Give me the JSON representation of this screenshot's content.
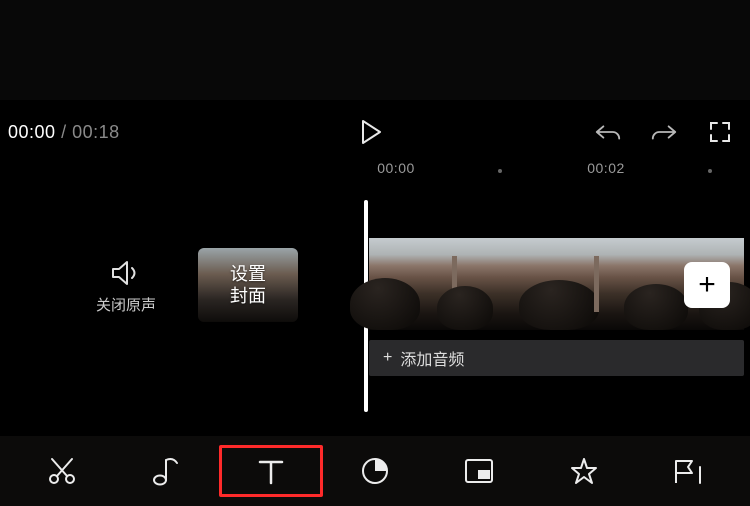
{
  "time": {
    "current": "00:00",
    "separator": "/",
    "duration": "00:18"
  },
  "ruler": {
    "t0": "00:00",
    "t1": "00:02"
  },
  "mute": {
    "label": "关闭原声"
  },
  "cover": {
    "line1": "设置",
    "line2": "封面"
  },
  "add": {
    "symbol": "+"
  },
  "audio": {
    "plus": "+",
    "label": "添加音频"
  },
  "tools": {
    "cut": "scissors-icon",
    "music": "music-note-icon",
    "text": "text-icon",
    "sticker": "sticker-icon",
    "pip": "picture-in-picture-icon",
    "effect": "star-effect-icon",
    "more": "flag-icon"
  }
}
